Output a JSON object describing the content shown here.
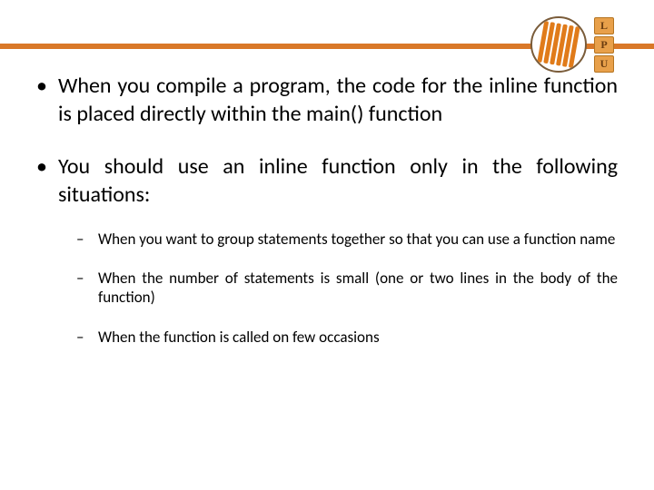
{
  "header": {
    "badges": [
      "L",
      "P",
      "U"
    ]
  },
  "bullets": [
    {
      "text": "When you compile a program, the code for the inline function is placed directly within the main() function",
      "sub": []
    },
    {
      "text": "You should use an inline function only in the following situations:",
      "sub": [
        "When you want to group statements together so that you can use a function name",
        "When the number of statements is small (one or two lines in the body of the function)",
        "When the function is called on few occasions"
      ]
    }
  ]
}
